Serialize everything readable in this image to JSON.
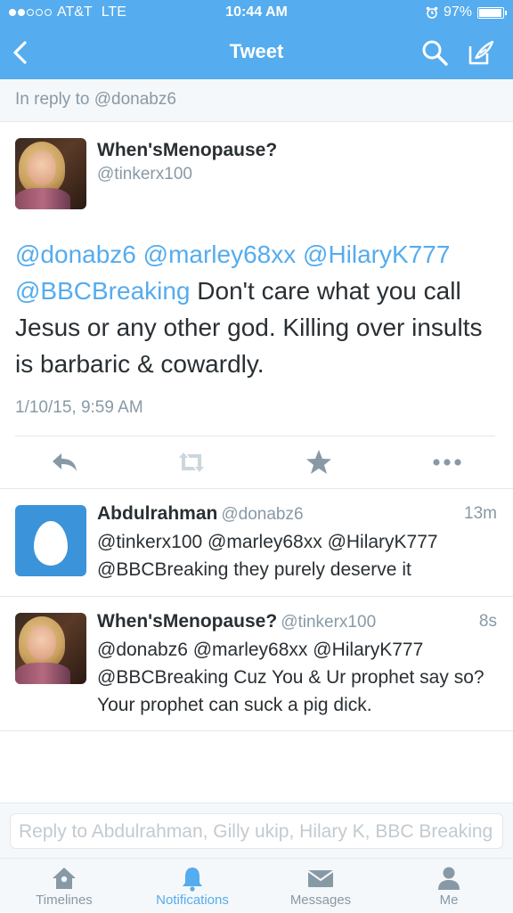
{
  "status_bar": {
    "carrier": "AT&T",
    "network": "LTE",
    "time": "10:44 AM",
    "battery": "97%",
    "battery_level": 0.97
  },
  "nav": {
    "title": "Tweet",
    "back_icon": "chevron-left-icon",
    "search_icon": "search-icon",
    "compose_icon": "compose-icon"
  },
  "reply_context": "In reply to @donabz6",
  "main_tweet": {
    "name": "When'sMenopause?",
    "handle": "@tinkerx100",
    "mentions": [
      "@donabz6",
      "@marley68xx",
      "@HilaryK777",
      "@BBCBreaking"
    ],
    "text": "Don't  care what you call Jesus or any other god. Killing over insults is barbaric & cowardly.",
    "date": "1/10/15, 9:59 AM",
    "actions": [
      "reply-icon",
      "retweet-icon",
      "favorite-icon",
      "more-icon"
    ]
  },
  "replies": [
    {
      "name": "Abdulrahman",
      "handle": "@donabz6",
      "ago": "13m",
      "text": "@tinkerx100 @marley68xx @HilaryK777 @BBCBreaking they purely deserve it"
    },
    {
      "name": "When'sMenopause?",
      "handle": "@tinkerx100",
      "ago": "8s",
      "text": "@donabz6 @marley68xx @HilaryK777 @BBCBreaking Cuz You & Ur prophet say so? Your prophet can suck a pig dick."
    }
  ],
  "compose": {
    "placeholder": "Reply to Abdulrahman, Gilly ukip, Hilary K, BBC Breaking"
  },
  "tabs": [
    {
      "label": "Timelines",
      "icon": "home-icon"
    },
    {
      "label": "Notifications",
      "icon": "bell-icon"
    },
    {
      "label": "Messages",
      "icon": "envelope-icon"
    },
    {
      "label": "Me",
      "icon": "person-icon"
    }
  ],
  "colors": {
    "brand": "#55acee",
    "text": "#292f33",
    "muted": "#8899a6"
  }
}
